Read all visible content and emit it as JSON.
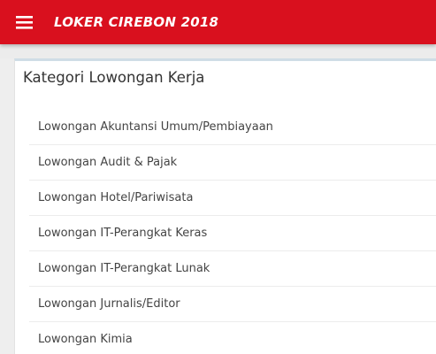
{
  "app_bar": {
    "title": "LOKER CIREBON 2018",
    "background": "#d9101e",
    "menu_icon": "hamburger-menu-icon"
  },
  "card": {
    "title": "Kategori Lowongan Kerja",
    "items": [
      {
        "label": "Lowongan Akuntansi Umum/Pembiayaan"
      },
      {
        "label": "Lowongan Audit & Pajak"
      },
      {
        "label": "Lowongan Hotel/Pariwisata"
      },
      {
        "label": "Lowongan IT-Perangkat Keras"
      },
      {
        "label": "Lowongan IT-Perangkat Lunak"
      },
      {
        "label": "Lowongan Jurnalis/Editor"
      },
      {
        "label": "Lowongan Kimia"
      }
    ]
  }
}
